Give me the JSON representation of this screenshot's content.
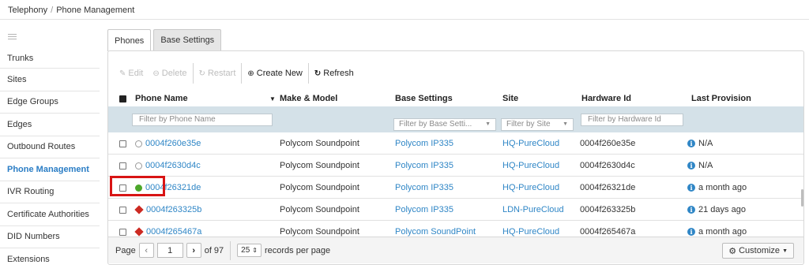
{
  "breadcrumb": {
    "root": "Telephony",
    "separator": "/",
    "current": "Phone Management"
  },
  "sidebar": {
    "items": [
      {
        "label": "Trunks",
        "active": false
      },
      {
        "label": "Sites",
        "active": false
      },
      {
        "label": "Edge Groups",
        "active": false
      },
      {
        "label": "Edges",
        "active": false
      },
      {
        "label": "Outbound Routes",
        "active": false
      },
      {
        "label": "Phone Management",
        "active": true
      },
      {
        "label": "IVR Routing",
        "active": false
      },
      {
        "label": "Certificate Authorities",
        "active": false
      },
      {
        "label": "DID Numbers",
        "active": false
      },
      {
        "label": "Extensions",
        "active": false
      }
    ]
  },
  "tabs": [
    {
      "label": "Phones",
      "active": true
    },
    {
      "label": "Base Settings",
      "active": false
    }
  ],
  "toolbar": {
    "edit": "Edit",
    "delete": "Delete",
    "restart": "Restart",
    "create_new": "Create New",
    "refresh": "Refresh"
  },
  "table": {
    "columns": {
      "phone_name": "Phone Name",
      "make_model": "Make & Model",
      "base_settings": "Base Settings",
      "site": "Site",
      "hardware_id": "Hardware Id",
      "last_provision": "Last Provision"
    },
    "filters": {
      "phone_name": "Filter by Phone Name",
      "base_settings": "Filter by Base Setti...",
      "site": "Filter by Site",
      "hardware_id": "Filter by Hardware Id"
    },
    "rows": [
      {
        "name": "0004f260e35e",
        "status": "unknown",
        "model": "Polycom Soundpoint",
        "base": "Polycom IP335",
        "site": "HQ-PureCloud",
        "hw": "0004f260e35e",
        "provision": "N/A"
      },
      {
        "name": "0004f2630d4c",
        "status": "unknown",
        "model": "Polycom Soundpoint",
        "base": "Polycom IP335",
        "site": "HQ-PureCloud",
        "hw": "0004f2630d4c",
        "provision": "N/A"
      },
      {
        "name": "0004f26321de",
        "status": "online",
        "model": "Polycom Soundpoint",
        "base": "Polycom IP335",
        "site": "HQ-PureCloud",
        "hw": "0004f26321de",
        "provision": "a month ago"
      },
      {
        "name": "0004f263325b",
        "status": "error",
        "model": "Polycom Soundpoint",
        "base": "Polycom IP335",
        "site": "LDN-PureCloud",
        "hw": "0004f263325b",
        "provision": "21 days ago"
      },
      {
        "name": "0004f265467a",
        "status": "error",
        "model": "Polycom Soundpoint",
        "base": "Polycom SoundPoint",
        "site": "HQ-PureCloud",
        "hw": "0004f265467a",
        "provision": "a month ago"
      }
    ]
  },
  "pager": {
    "page_label": "Page",
    "current_page": "1",
    "of_label": "of 97",
    "per_page": "25",
    "per_page_label": "records per page",
    "customize": "Customize"
  },
  "colors": {
    "link": "#2f86c6",
    "active_nav": "#2a7dc5",
    "filter_bg": "#d4e1e8",
    "online": "#4ca72a",
    "error": "#cc2a22",
    "highlight": "#d81414"
  }
}
